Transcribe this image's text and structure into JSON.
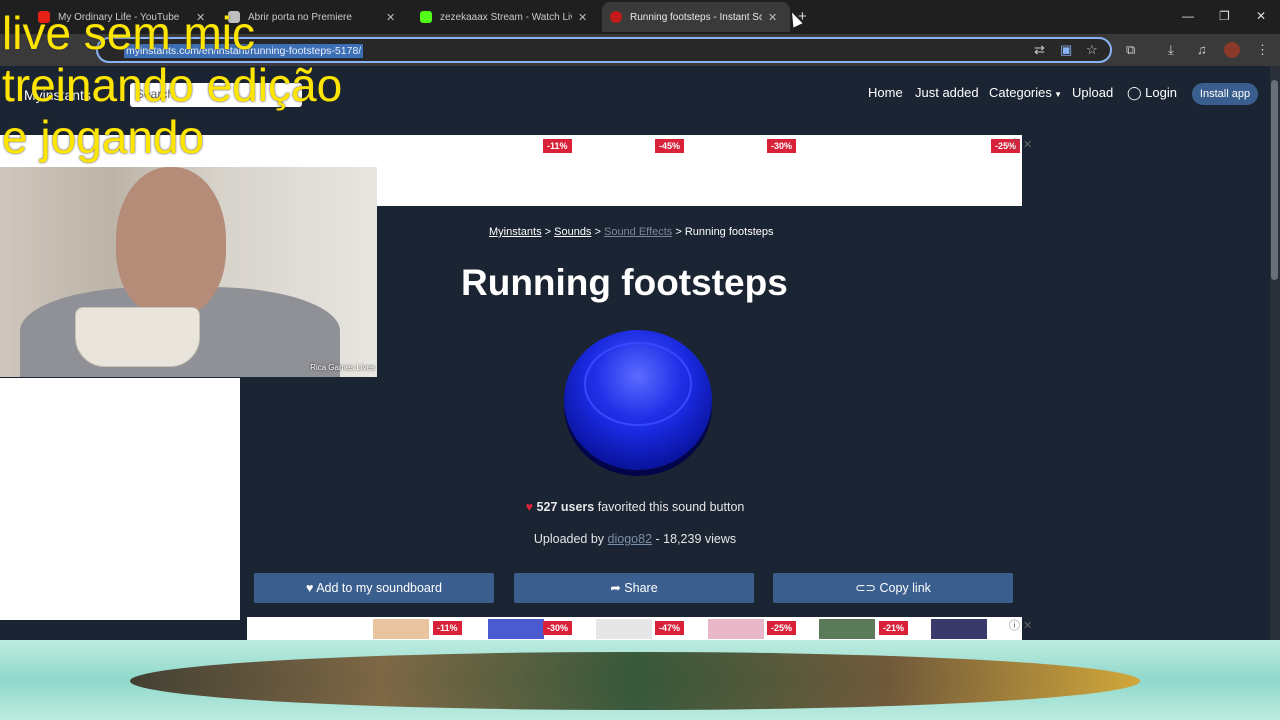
{
  "browser": {
    "tabs": [
      {
        "title": "My Ordinary Life - YouTube",
        "favicon_color": "#e62117"
      },
      {
        "title": "Abrir porta no Premiere",
        "favicon_color": "#bfbfbf"
      },
      {
        "title": "zezekaaax Stream - Watch Live",
        "favicon_color": "#53fc18"
      },
      {
        "title": "Running footsteps - Instant So",
        "favicon_color": "#c21a1a"
      }
    ],
    "new_tab": "+",
    "url": "myinstants.com/en/instant/running-footsteps-5178/",
    "window_controls": [
      "—",
      "❐",
      "✕"
    ]
  },
  "site": {
    "brand": "Myinstants",
    "search_placeholder": "Search",
    "nav": [
      "Home",
      "Just added",
      "Categories",
      "Upload",
      "Login"
    ],
    "install_app": "Install app",
    "ad_discounts_top": [
      "-11%",
      "-45%",
      "-30%",
      "-25%"
    ],
    "breadcrumb": [
      "Myinstants",
      "Sounds",
      "Sound Effects",
      "Running footsteps"
    ],
    "title": "Running footsteps",
    "favorites": {
      "count": "527 users",
      "text": "favorited this sound button"
    },
    "uploaded": {
      "prefix": "Uploaded by",
      "user": "diogo82",
      "views": "- 18,239 views"
    },
    "actions": [
      "Add to my soundboard",
      "Share",
      "Copy link"
    ],
    "ad_discounts_bottom": [
      "-11%",
      "-30%",
      "-47%",
      "-25%",
      "-21%"
    ],
    "colors": {
      "page_bg": "#1b2432",
      "accent": "#3a5f8e",
      "sound_button": "#1a2ae0"
    }
  },
  "overlay": {
    "lines": [
      "live sem mic",
      "treinando edição",
      "e jogando"
    ],
    "cam_label": "Rica Games Lives"
  }
}
